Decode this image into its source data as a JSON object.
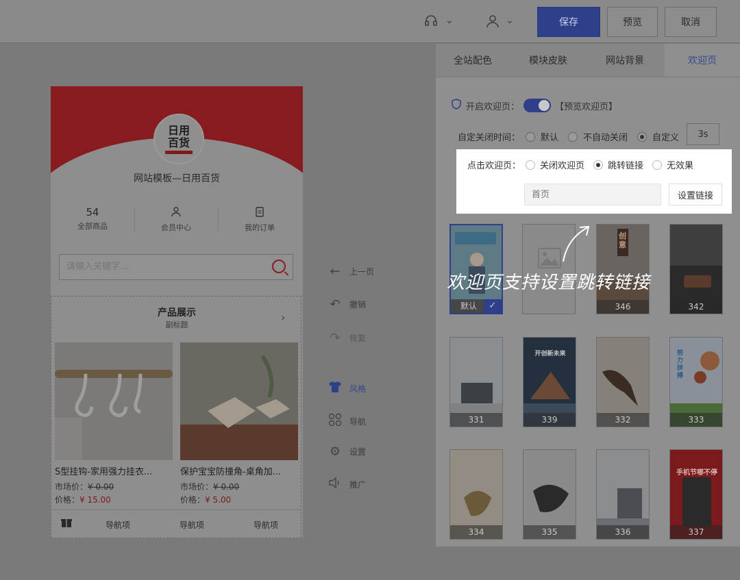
{
  "toolbar": {
    "save": "保存",
    "preview": "预览",
    "cancel": "取消"
  },
  "phone": {
    "logo_line1": "日用",
    "logo_line2": "百货",
    "site_title": "网站模板—日用百货",
    "stats": [
      {
        "num": "54",
        "label": "全部商品"
      },
      {
        "num": "",
        "label": "会员中心"
      },
      {
        "num": "",
        "label": "我的订单"
      }
    ],
    "search_placeholder": "请输入关键字...",
    "section_title": "产品展示",
    "section_subtitle": "副标题",
    "products": [
      {
        "name": "S型挂钩-家用强力挂衣...",
        "market_label": "市场价：",
        "market_price": "¥ 0.00",
        "price_label": "价格：",
        "price": "¥ 15.00"
      },
      {
        "name": "保护宝宝防撞角-桌角加...",
        "market_label": "市场价：",
        "market_price": "¥ 0.00",
        "price_label": "价格：",
        "price": "¥ 5.00"
      }
    ],
    "nav_items": [
      "导航项",
      "导航项",
      "导航项"
    ]
  },
  "tools": [
    "上一页",
    "撤销",
    "恢复",
    "风格",
    "导航",
    "设置",
    "推广"
  ],
  "right_panel": {
    "tabs": [
      "全站配色",
      "模块皮肤",
      "网站背景",
      "欢迎页"
    ],
    "enable_label": "开启欢迎页：",
    "preview_link": "【预览欢迎页】",
    "close_time_label": "自定关闭时间：",
    "close_options": [
      "默认",
      "不自动关闭",
      "自定义"
    ],
    "custom_value": "3s",
    "click_label": "点击欢迎页：",
    "click_options": [
      "关闭欢迎页",
      "跳转链接",
      "无效果"
    ],
    "link_placeholder": "首页",
    "link_button": "设置链接",
    "templates": [
      "默认",
      "346",
      "342",
      "331",
      "339",
      "332",
      "333",
      "334",
      "335",
      "336",
      "337"
    ],
    "thumb_texts": {
      "t1": "创意",
      "t6": "开创新未来",
      "t8": "努力拼搏",
      "t12": "手机节哪不停"
    }
  },
  "annotation": "欢迎页支持设置跳转链接",
  "colors": {
    "accent": "#2f3f8a",
    "brand_red": "#871b1e",
    "overlay": "#7a7a7a"
  }
}
